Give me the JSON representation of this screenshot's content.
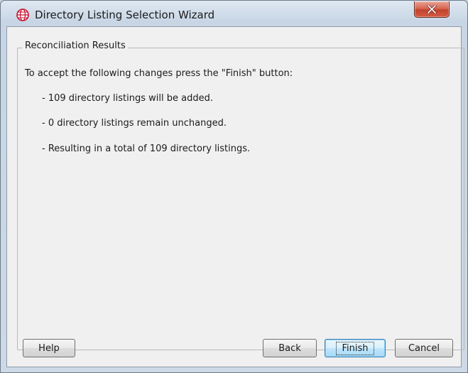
{
  "window": {
    "title": "Directory Listing Selection Wizard",
    "app_icon": "globe-icon",
    "close_icon": "close-icon"
  },
  "group": {
    "legend": "Reconciliation Results"
  },
  "messages": {
    "intro": "To accept the following changes press the \"Finish\" button:",
    "lines": [
      "- 109 directory listings will be added.",
      "- 0 directory listings remain unchanged.",
      "- Resulting in a total of 109 directory listings."
    ]
  },
  "buttons": {
    "help": "Help",
    "back": "Back",
    "finish": "Finish",
    "cancel": "Cancel"
  },
  "colors": {
    "close_button": "#c2432e",
    "app_icon": "#c8102e",
    "default_button_border": "#3c7fb1"
  }
}
